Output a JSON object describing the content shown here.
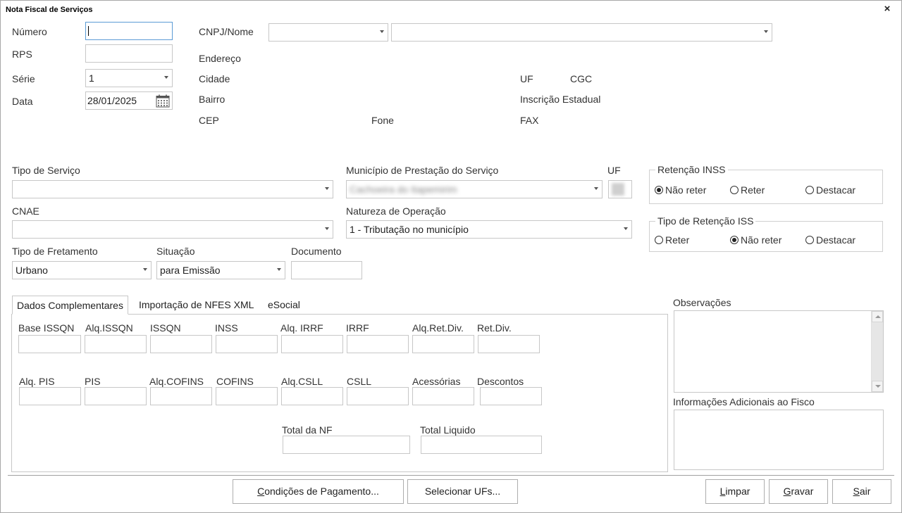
{
  "window": {
    "title": "Nota Fiscal de Serviços",
    "close_glyph": "×"
  },
  "left": {
    "numero_label": "Número",
    "numero_value": "",
    "rps_label": "RPS",
    "rps_value": "",
    "serie_label": "Série",
    "serie_value": "1",
    "data_label": "Data",
    "data_value": "28/01/2025"
  },
  "client": {
    "cnpj_label": "CNPJ/Nome",
    "cnpj_value": "",
    "nome_value": "",
    "endereco_label": "Endereço",
    "cidade_label": "Cidade",
    "bairro_label": "Bairro",
    "cep_label": "CEP",
    "fone_label": "Fone",
    "uf_label": "UF",
    "cgc_label": "CGC",
    "ie_label": "Inscrição Estadual",
    "fax_label": "FAX"
  },
  "service": {
    "tipo_servico_label": "Tipo de Serviço",
    "tipo_servico_value": "",
    "municipio_label": "Município de Prestação do Serviço",
    "municipio_value": "Cachoeira do Itapemirim",
    "uf_label": "UF",
    "cnae_label": "CNAE",
    "cnae_value": "",
    "natureza_label": "Natureza de Operação",
    "natureza_value": "1 - Tributação no município",
    "fretamento_label": "Tipo de Fretamento",
    "fretamento_value": "Urbano",
    "situacao_label": "Situação",
    "situacao_value": "para Emissão",
    "documento_label": "Documento",
    "documento_value": ""
  },
  "retencao_inss": {
    "title": "Retenção INSS",
    "options": [
      "Não reter",
      "Reter",
      "Destacar"
    ],
    "selected": "Não reter"
  },
  "retencao_iss": {
    "title": "Tipo de Retenção ISS",
    "options": [
      "Reter",
      "Não reter",
      "Destacar"
    ],
    "selected": "Não reter"
  },
  "tabs": [
    "Dados Complementares",
    "Importação de NFES XML",
    "eSocial"
  ],
  "complementares": {
    "row1": [
      "Base ISSQN",
      "Alq.ISSQN",
      "ISSQN",
      "INSS",
      "Alq. IRRF",
      "IRRF",
      "Alq.Ret.Div.",
      "Ret.Div."
    ],
    "row2": [
      "Alq. PIS",
      "PIS",
      "Alq.COFINS",
      "COFINS",
      "Alq.CSLL",
      "CSLL",
      "Acessórias",
      "Descontos"
    ],
    "total_nf_label": "Total da NF",
    "total_liquido_label": "Total Liquido"
  },
  "observacoes_label": "Observações",
  "info_fisco_label": "Informações Adicionais ao Fisco",
  "buttons": {
    "condicoes_pre": "",
    "condicoes_key": "C",
    "condicoes_post": "ondições de Pagamento...",
    "selecionar": "Selecionar UFs...",
    "limpar_key": "L",
    "limpar_post": "impar",
    "gravar_key": "G",
    "gravar_post": "ravar",
    "sair_key": "S",
    "sair_post": "air"
  }
}
